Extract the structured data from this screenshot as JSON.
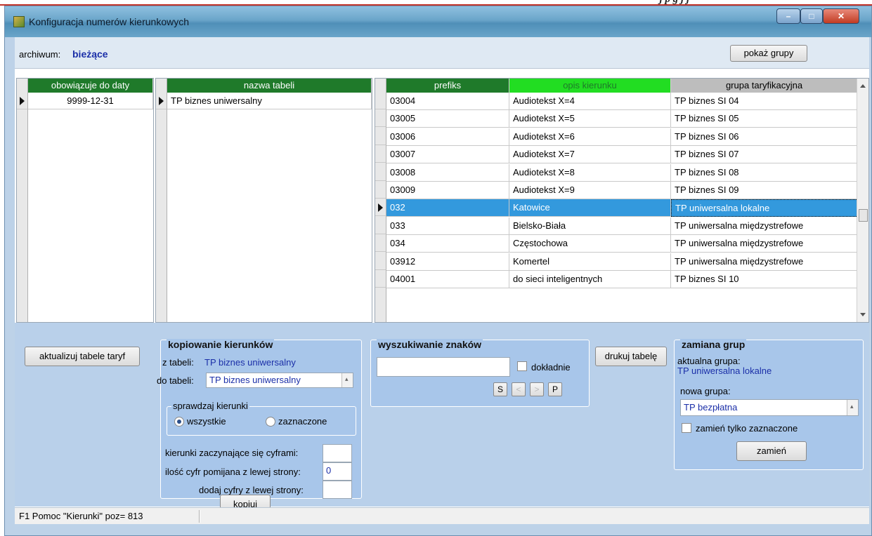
{
  "window": {
    "title": "Konfiguracja numerów kierunkowych"
  },
  "archiv": {
    "label": "archiwum:",
    "value": "bieżące",
    "show_groups_button": "pokaż grupy"
  },
  "grid_dates": {
    "header": "obowiązuje do daty",
    "rows": [
      "9999-12-31"
    ]
  },
  "grid_tables": {
    "header": "nazwa tabeli",
    "rows": [
      "TP biznes uniwersalny"
    ]
  },
  "grid_prefixes": {
    "headers": [
      "prefiks",
      "opis kierunku",
      "grupa taryfikacyjna"
    ],
    "rows": [
      [
        "03004",
        "Audiotekst X=4",
        "TP biznes SI 04"
      ],
      [
        "03005",
        "Audiotekst X=5",
        "TP biznes SI 05"
      ],
      [
        "03006",
        "Audiotekst X=6",
        "TP biznes SI 06"
      ],
      [
        "03007",
        "Audiotekst X=7",
        "TP biznes SI 07"
      ],
      [
        "03008",
        "Audiotekst X=8",
        "TP biznes SI 08"
      ],
      [
        "03009",
        "Audiotekst X=9",
        "TP biznes SI 09"
      ],
      [
        "032",
        "Katowice",
        "TP uniwersalna lokalne"
      ],
      [
        "033",
        "Bielsko-Biała",
        "TP uniwersalna międzystrefowe"
      ],
      [
        "034",
        "Częstochowa",
        "TP uniwersalna międzystrefowe"
      ],
      [
        "03912",
        "Komertel",
        "TP uniwersalna międzystrefowe"
      ],
      [
        "04001",
        "do sieci inteligentnych",
        "TP biznes SI 10"
      ]
    ]
  },
  "actions": {
    "update_button": "aktualizuj tabele taryf",
    "print_button": "drukuj tabelę"
  },
  "copy_panel": {
    "title": "kopiowanie kierunków",
    "from_label": "z tabeli:",
    "from_value": "TP biznes uniwersalny",
    "to_label": "do tabeli:",
    "to_value": "TP biznes uniwersalny",
    "check_group_title": "sprawdzaj kierunki",
    "radio_all": "wszystkie",
    "radio_selected": "zaznaczone",
    "starting_label": "kierunki zaczynające się cyframi:",
    "starting_value": "",
    "skip_label": "ilość cyfr pomijana z lewej strony:",
    "skip_value": "0",
    "add_label": "dodaj cyfry z lewej strony:",
    "add_value": "",
    "copy_button": "kopiuj"
  },
  "search_panel": {
    "title": "wyszukiwanie znaków",
    "input_value": "",
    "exact_label": "dokładnie",
    "btn_s": "S",
    "btn_prev": "<",
    "btn_next": ">",
    "btn_p": "P"
  },
  "group_panel": {
    "title": "zamiana grup",
    "current_label": "aktualna grupa:",
    "current_value": "TP uniwersalna lokalne",
    "new_label": "nowa grupa:",
    "new_value": "TP bezpłatna",
    "only_selected_label": "zamień tylko zaznaczone",
    "replace_button": "zamień"
  },
  "status": {
    "text": "F1 Pomoc  \"Kierunki\" poz= 813"
  },
  "colors": {
    "header_green": "#1f7a2a",
    "header_bright": "#22dd22",
    "selection": "#3399dd",
    "panel_bg": "#a8c6ea"
  }
}
